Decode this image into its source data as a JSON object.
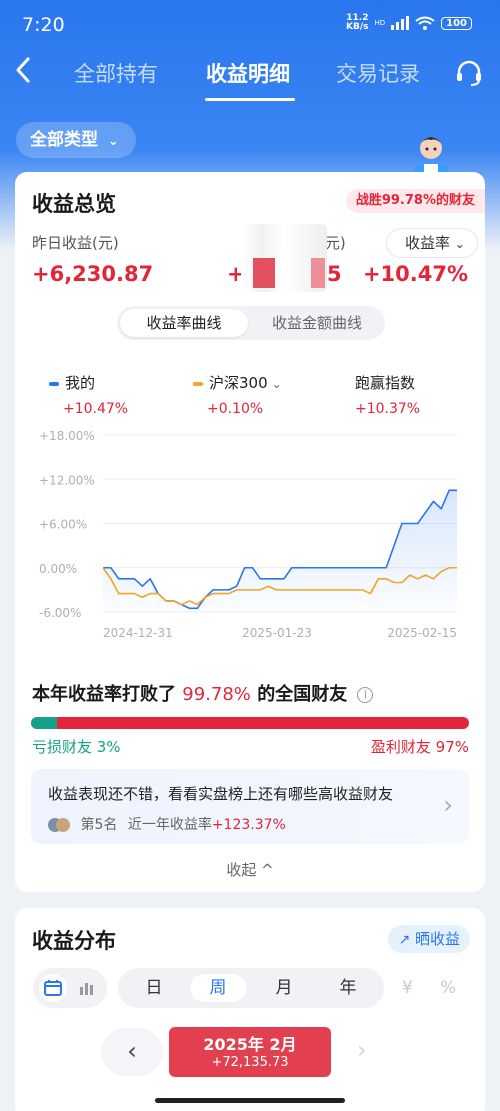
{
  "status_bar": {
    "time": "7:20",
    "net_speed_value": "11.2",
    "net_speed_unit": "KB/s",
    "network": "HD",
    "battery": "100"
  },
  "nav": {
    "tabs": [
      "全部持有",
      "收益明细",
      "交易记录"
    ],
    "active_tab": "收益明细"
  },
  "filter": {
    "type_label": "全部类型"
  },
  "overview": {
    "title": "收益总览",
    "beat_badge": "战胜99.78%的财友",
    "yesterday_label": "昨日收益(元)",
    "yesterday_value": "+6,230.87",
    "middle_label_partial": "(元)",
    "middle_value_start": "+7",
    "middle_value_end": "5",
    "rate_label": "收益率",
    "rate_value": "+10.47%"
  },
  "curve_toggle": {
    "options": [
      "收益率曲线",
      "收益金额曲线"
    ],
    "active": "收益率曲线"
  },
  "legend": [
    {
      "name": "我的",
      "value": "+10.47%",
      "color": "#2a76ee"
    },
    {
      "name": "沪深300",
      "value": "+0.10%",
      "color": "#f0a623",
      "dropdown": true
    },
    {
      "name": "跑赢指数",
      "value": "+10.37%"
    }
  ],
  "chart_data": {
    "type": "line",
    "y_ticks": [
      "+18.00%",
      "+12.00%",
      "+6.00%",
      "0.00%",
      "-6.00%"
    ],
    "ylim": [
      -6,
      18
    ],
    "x_ticks": [
      "2024-12-31",
      "2025-01-23",
      "2025-02-15"
    ],
    "grid": true,
    "series": [
      {
        "name": "我的",
        "color": "#2a76ee",
        "fill": true,
        "values": [
          0,
          0,
          -1.5,
          -1.5,
          -1.5,
          -2.5,
          -1.5,
          -3.5,
          -4.5,
          -4.5,
          -5,
          -5.5,
          -5.5,
          -4,
          -3,
          -3,
          -3,
          -2.5,
          0,
          0,
          -1.5,
          -1.5,
          -1.5,
          -1.5,
          0,
          0,
          0,
          0,
          0,
          0,
          0,
          0,
          0,
          0,
          0,
          0,
          0,
          3,
          6,
          6,
          6,
          7.5,
          9,
          8,
          10.5,
          10.5
        ]
      },
      {
        "name": "沪深300",
        "color": "#f0a623",
        "fill": false,
        "values": [
          0,
          -1.5,
          -3.5,
          -3.5,
          -3.5,
          -4,
          -3.5,
          -3.5,
          -4.5,
          -4.5,
          -5,
          -4.5,
          -5,
          -4,
          -3.5,
          -3.5,
          -3.5,
          -3,
          -3,
          -3,
          -3,
          -2.5,
          -3,
          -3,
          -3,
          -3,
          -3,
          -3,
          -3,
          -3,
          -3,
          -3,
          -3,
          -3,
          -3.5,
          -1.5,
          -1.5,
          -2,
          -2,
          -1,
          -1.5,
          -1,
          -1.5,
          -0.5,
          0,
          0
        ]
      }
    ]
  },
  "beat": {
    "prefix": "本年收益率打败了",
    "pct": "99.78%",
    "suffix": "的全国财友",
    "info": "i"
  },
  "distribution_bar": {
    "loss_label": "亏损财友 3%",
    "profit_label": "盈利财友 97%",
    "loss_fraction": 0.03
  },
  "promo": {
    "text": "收益表现还不错，看看实盘榜上还有哪些高收益财友",
    "rank": "第5名",
    "sub_label": "近一年收益率",
    "sub_value": "+123.37%"
  },
  "collapse_label": "收起 ^",
  "dist": {
    "title": "收益分布",
    "share_label": "晒收益",
    "periods": [
      "日",
      "周",
      "月",
      "年"
    ],
    "active_period": "周",
    "unit_yuan": "¥",
    "unit_pct": "%",
    "month_label": "2025年 2月",
    "month_value": "+72,135.73"
  }
}
